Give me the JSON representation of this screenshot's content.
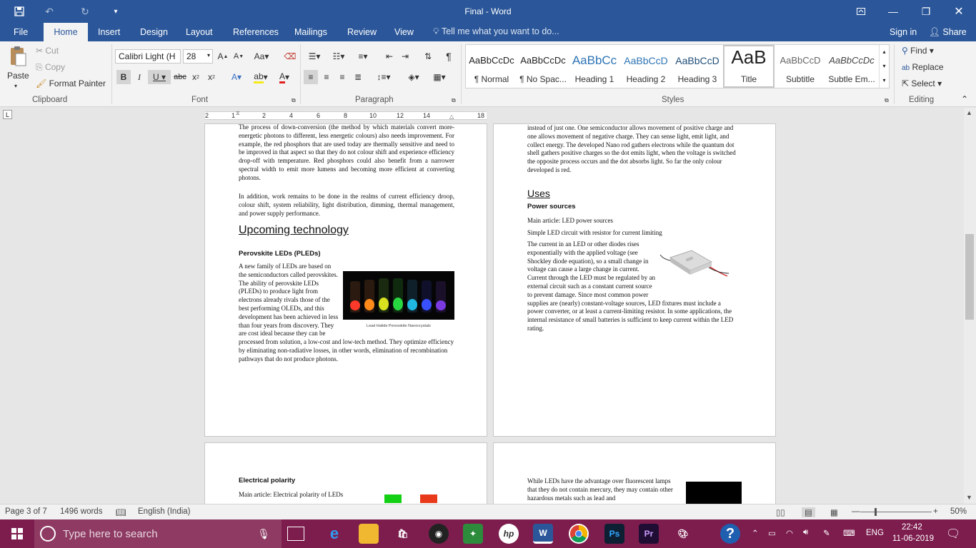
{
  "titlebar": {
    "title": "Final - Word"
  },
  "menu": {
    "file": "File",
    "home": "Home",
    "insert": "Insert",
    "design": "Design",
    "layout": "Layout",
    "references": "References",
    "mailings": "Mailings",
    "review": "Review",
    "view": "View",
    "tell_me": "Tell me what you want to do...",
    "sign_in": "Sign in",
    "share": "Share"
  },
  "clipboard": {
    "paste": "Paste",
    "cut": "Cut",
    "copy": "Copy",
    "format_painter": "Format Painter",
    "label": "Clipboard"
  },
  "font": {
    "name": "Calibri Light (H",
    "size": "28",
    "label": "Font"
  },
  "paragraph": {
    "label": "Paragraph"
  },
  "styles": {
    "label": "Styles",
    "items": [
      {
        "sample": "AaBbCcDc",
        "name": "¶ Normal"
      },
      {
        "sample": "AaBbCcDc",
        "name": "¶ No Spac..."
      },
      {
        "sample": "AaBbCc",
        "name": "Heading 1"
      },
      {
        "sample": "AaBbCcD",
        "name": "Heading 2"
      },
      {
        "sample": "AaBbCcD",
        "name": "Heading 3"
      },
      {
        "sample": "AaB",
        "name": "Title"
      },
      {
        "sample": "AaBbCcD",
        "name": "Subtitle"
      },
      {
        "sample": "AaBbCcDc",
        "name": "Subtle Em..."
      }
    ]
  },
  "editing": {
    "find": "Find",
    "replace": "Replace",
    "select": "Select",
    "label": "Editing"
  },
  "ruler": {
    "numbers": [
      "2",
      "1",
      "2",
      "4",
      "6",
      "8",
      "10",
      "12",
      "14",
      "18"
    ]
  },
  "page_left": {
    "para1": "The process of down-conversion (the method by which materials convert more-energetic photons to different, less energetic colours) also needs improvement. For example, the red phosphors that are used today are thermally sensitive and need to be improved in that aspect so that they do not colour shift and experience efficiency drop-off with temperature. Red phosphors could also benefit from a narrower spectral width to emit more lumens and becoming more efficient at converting photons.",
    "para2": "In addition, work remains to be done in the realms of current efficiency droop, colour shift, system reliability, light distribution, dimming, thermal management, and power supply performance.",
    "heading": "Upcoming technology",
    "subheading": "Perovskite LEDs (PLEDs)",
    "para3a": "A new family of LEDs are based on the semiconductors called perovskites. The ability of perovskite LEDs (PLEDs) to produce light from electrons already rivals those of the best performing OLEDs, and this development has been achieved in less than four years from discovery. They are cost",
    "para3b": "ideal because they can be processed from solution, a low-cost and low-tech method. They optimize efficiency by eliminating non-radiative losses, in other words, elimination of recombination pathways that do not produce photons.",
    "caption": "Lead Halide Perovskite Nanocrystals"
  },
  "page_right": {
    "para1": "instead of just one. One semiconductor allows movement of positive charge and one allows movement of negative charge. They can sense light, emit light, and collect energy. The developed Nano rod gathers electrons while the quantum dot shell gathers positive charges so the dot emits light, when the voltage is switched the opposite process occurs and the dot absorbs light. So far the only colour developed is red.",
    "heading": "Uses",
    "subheading": "Power sources",
    "main_article": "Main article: LED power sources",
    "simple_circuit": "Simple LED circuit with resistor for current limiting",
    "para2a": "The current in an LED or other diodes rises exponentially with the applied voltage (see Shockley diode equation), so a small change in voltage can cause a large change in current. Current through the LED must be regulated by an external circuit such",
    "para2b": "as a constant current source to prevent damage. Since most common power supplies are (nearly) constant-voltage sources, LED fixtures must include a power converter, or at least a current-limiting resistor. In some applications, the internal resistance of small batteries is sufficient to keep current within the LED rating."
  },
  "page_bottom_left": {
    "heading": "Electrical polarity",
    "main_article": "Main article: Electrical polarity of LEDs"
  },
  "page_bottom_right": {
    "para": "While LEDs have the advantage over fluorescent lamps that they do not contain mercury, they may contain other hazardous metals such as lead and"
  },
  "status": {
    "page": "Page 3 of 7",
    "words": "1496 words",
    "language": "English (India)",
    "zoom": "50%"
  },
  "taskbar": {
    "search_placeholder": "Type here to search",
    "lang": "ENG",
    "time": "22:42",
    "date": "11-06-2019"
  }
}
